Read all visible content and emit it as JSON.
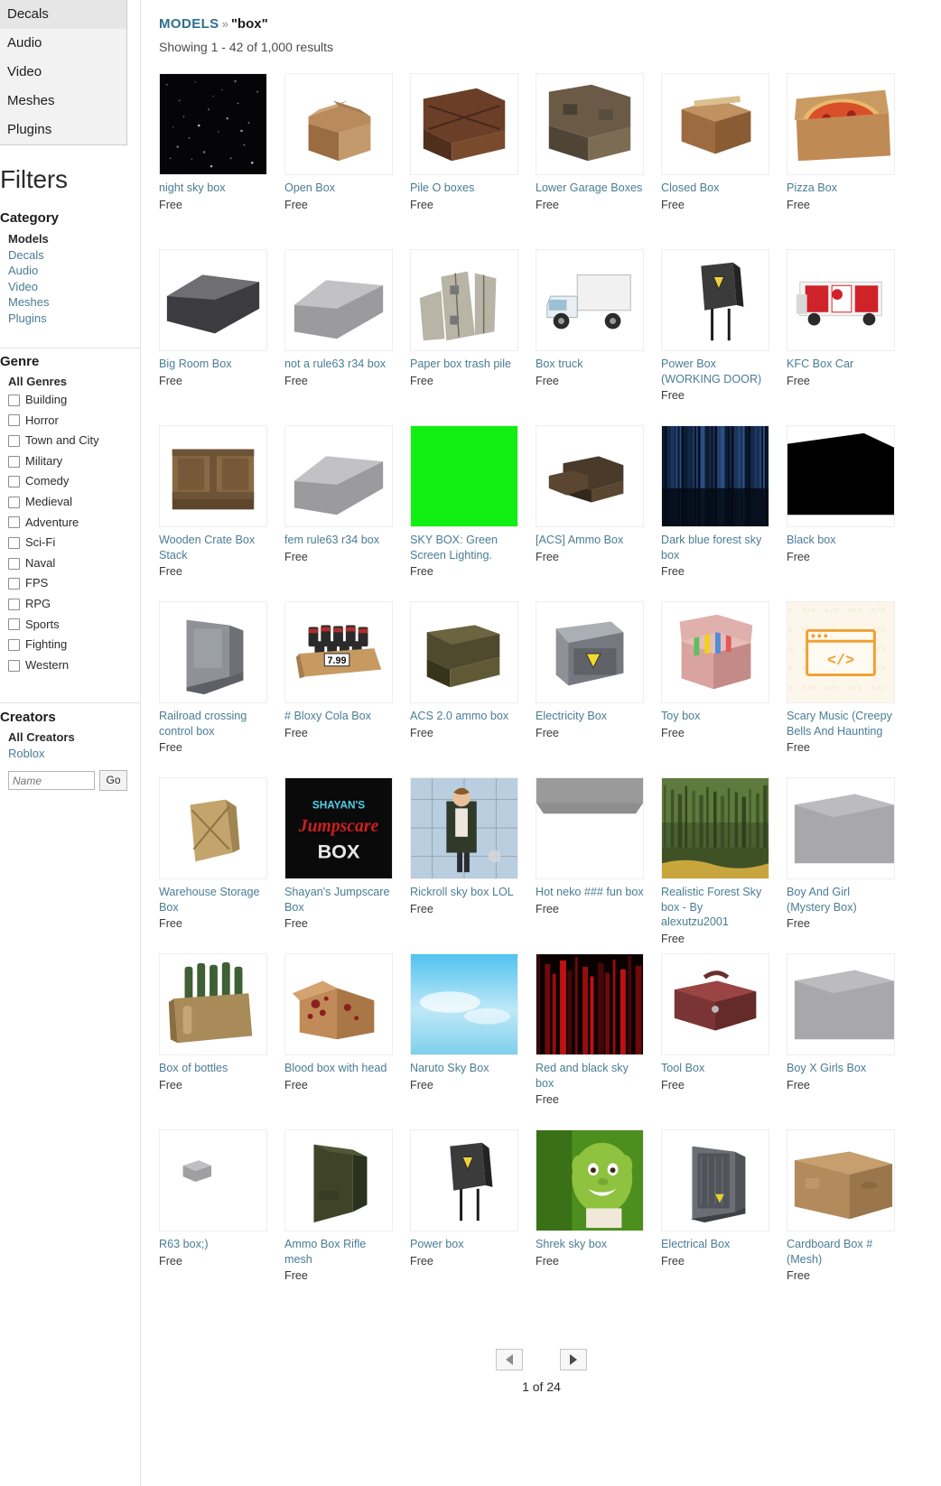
{
  "type_menu": {
    "items": [
      "Decals",
      "Audio",
      "Video",
      "Meshes",
      "Plugins"
    ]
  },
  "filters": {
    "title": "Filters",
    "category": {
      "heading": "Category",
      "items": [
        "Models",
        "Decals",
        "Audio",
        "Video",
        "Meshes",
        "Plugins"
      ],
      "active": "Models"
    },
    "genre": {
      "heading": "Genre",
      "all_label": "All Genres",
      "items": [
        "Building",
        "Horror",
        "Town and City",
        "Military",
        "Comedy",
        "Medieval",
        "Adventure",
        "Sci-Fi",
        "Naval",
        "FPS",
        "RPG",
        "Sports",
        "Fighting",
        "Western"
      ]
    },
    "creators": {
      "heading": "Creators",
      "all_label": "All Creators",
      "roblox_label": "Roblox",
      "name_placeholder": "Name",
      "name_value": "",
      "go_label": "Go"
    }
  },
  "breadcrumb": {
    "models_label": "MODELS",
    "separator": "»",
    "query": "\"box\""
  },
  "results_count": "Showing 1 - 42 of 1,000 results",
  "price_label": "Free",
  "items": [
    {
      "name": "night sky box",
      "price": "Free",
      "art": "nightsky"
    },
    {
      "name": "Open Box",
      "price": "Free",
      "art": "openbox"
    },
    {
      "name": "Pile O boxes",
      "price": "Free",
      "art": "pileboxes"
    },
    {
      "name": "Lower Garage Boxes",
      "price": "Free",
      "art": "garageboxes"
    },
    {
      "name": "Closed Box",
      "price": "Free",
      "art": "closedbox"
    },
    {
      "name": "Pizza Box",
      "price": "Free",
      "art": "pizzabox"
    },
    {
      "name": "Big Room Box",
      "price": "Free",
      "art": "bigroom"
    },
    {
      "name": "not a rule63 r34 box",
      "price": "Free",
      "art": "greybox"
    },
    {
      "name": "Paper box trash pile",
      "price": "Free",
      "art": "paperpile"
    },
    {
      "name": "Box truck",
      "price": "Free",
      "art": "boxtruck"
    },
    {
      "name": "Power Box (WORKING DOOR)",
      "price": "Free",
      "art": "powerbox"
    },
    {
      "name": "KFC Box Car",
      "price": "Free",
      "art": "kfccar"
    },
    {
      "name": "Wooden Crate Box Stack",
      "price": "Free",
      "art": "woodcrate"
    },
    {
      "name": "fem rule63 r34 box",
      "price": "Free",
      "art": "greybox2"
    },
    {
      "name": "SKY BOX: Green Screen Lighting.",
      "price": "Free",
      "art": "greenscreen"
    },
    {
      "name": "[ACS] Ammo Box",
      "price": "Free",
      "art": "ammobox"
    },
    {
      "name": "Dark blue forest sky box",
      "price": "Free",
      "art": "darkforest"
    },
    {
      "name": "Black box",
      "price": "Free",
      "art": "blackbox"
    },
    {
      "name": "Railroad crossing control box",
      "price": "Free",
      "art": "railroadbox"
    },
    {
      "name": "# Bloxy Cola Box",
      "price": "Free",
      "art": "colabox"
    },
    {
      "name": "ACS 2.0 ammo box",
      "price": "Free",
      "art": "acsammo"
    },
    {
      "name": "Electricity Box",
      "price": "Free",
      "art": "electricity"
    },
    {
      "name": "Toy box",
      "price": "Free",
      "art": "toybox"
    },
    {
      "name": "Scary Music (Creepy Bells And Haunting",
      "price": "Free",
      "art": "audioplaceholder"
    },
    {
      "name": "Warehouse Storage Box",
      "price": "Free",
      "art": "warehouse"
    },
    {
      "name": "Shayan's Jumpscare Box",
      "price": "Free",
      "art": "jumpscare"
    },
    {
      "name": "Rickroll sky box LOL",
      "price": "Free",
      "art": "rickroll"
    },
    {
      "name": "Hot neko ### fun box",
      "price": "Free",
      "art": "greyflat"
    },
    {
      "name": "Realistic Forest Sky box - By alexutzu2001",
      "price": "Free",
      "art": "forest"
    },
    {
      "name": "Boy And Girl (Mystery Box)",
      "price": "Free",
      "art": "greyslab"
    },
    {
      "name": "Box of bottles",
      "price": "Free",
      "art": "bottles"
    },
    {
      "name": "Blood box with head",
      "price": "Free",
      "art": "bloodbox"
    },
    {
      "name": "Naruto Sky Box",
      "price": "Free",
      "art": "narutosky"
    },
    {
      "name": "Red and black sky box",
      "price": "Free",
      "art": "redblack"
    },
    {
      "name": "Tool Box",
      "price": "Free",
      "art": "toolbox"
    },
    {
      "name": "Boy X Girls Box",
      "price": "Free",
      "art": "greyslab2"
    },
    {
      "name": "R63 box;)",
      "price": "Free",
      "art": "tinygrey"
    },
    {
      "name": "Ammo Box Rifle mesh",
      "price": "Free",
      "art": "ammorifle"
    },
    {
      "name": "Power box",
      "price": "Free",
      "art": "powerbox2"
    },
    {
      "name": "Shrek sky box",
      "price": "Free",
      "art": "shrek"
    },
    {
      "name": "Electrical Box",
      "price": "Free",
      "art": "electricalbox"
    },
    {
      "name": "Cardboard Box # (Mesh)",
      "price": "Free",
      "art": "cardboard"
    }
  ],
  "pager": {
    "prev_label": "◀",
    "next_label": "▶",
    "page_text": "1 of 24"
  },
  "colors": {
    "link": "#4a7c94",
    "heading": "#2b2b2b",
    "breadcrumb": "#2e6f8e",
    "border": "#e3e3e3"
  }
}
